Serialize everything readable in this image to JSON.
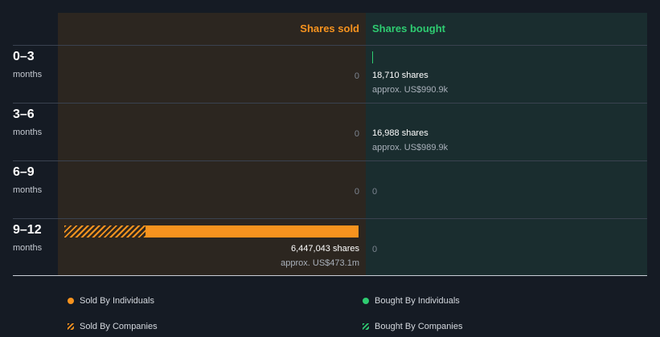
{
  "chart_data": {
    "type": "bar",
    "title": "",
    "categories": [
      "0–3",
      "3–6",
      "6–9",
      "9–12"
    ],
    "category_unit": "months",
    "column_headers": {
      "sold": "Shares sold",
      "bought": "Shares bought"
    },
    "series": [
      {
        "name": "Sold By Individuals",
        "side": "sold",
        "kind": "individuals",
        "values": [
          0,
          0,
          0,
          6447043
        ],
        "color": "#f7931e"
      },
      {
        "name": "Sold By Companies",
        "side": "sold",
        "kind": "companies",
        "values": [
          0,
          0,
          0,
          2071000
        ],
        "color": "#f7931e"
      },
      {
        "name": "Bought By Individuals",
        "side": "bought",
        "kind": "individuals",
        "values": [
          18710,
          16988,
          0,
          0
        ],
        "color": "#2ecc71"
      },
      {
        "name": "Bought By Companies",
        "side": "bought",
        "kind": "companies",
        "values": [
          0,
          0,
          0,
          0
        ],
        "color": "#2ecc71"
      }
    ],
    "rows": [
      {
        "period": "0–3",
        "unit": "months",
        "sold": {
          "text": "0",
          "shares": "",
          "approx": ""
        },
        "bought": {
          "text": "",
          "shares": "18,710 shares",
          "approx": "approx. US$990.9k"
        }
      },
      {
        "period": "3–6",
        "unit": "months",
        "sold": {
          "text": "0",
          "shares": "",
          "approx": ""
        },
        "bought": {
          "text": "",
          "shares": "16,988 shares",
          "approx": "approx. US$989.9k"
        }
      },
      {
        "period": "6–9",
        "unit": "months",
        "sold": {
          "text": "0",
          "shares": "",
          "approx": ""
        },
        "bought": {
          "text": "0",
          "shares": "",
          "approx": ""
        }
      },
      {
        "period": "9–12",
        "unit": "months",
        "sold": {
          "text": "",
          "shares": "6,447,043 shares",
          "approx": "approx. US$473.1m"
        },
        "bought": {
          "text": "0",
          "shares": "",
          "approx": ""
        }
      }
    ],
    "legend": {
      "placement": "bottom",
      "items": [
        {
          "label": "Sold By Individuals",
          "color": "#f7931e",
          "style": "solid"
        },
        {
          "label": "Bought By Individuals",
          "color": "#2ecc71",
          "style": "solid"
        },
        {
          "label": "Sold By Companies",
          "color": "#f7931e",
          "style": "hatched"
        },
        {
          "label": "Bought By Companies",
          "color": "#2ecc71",
          "style": "hatched"
        }
      ]
    }
  }
}
